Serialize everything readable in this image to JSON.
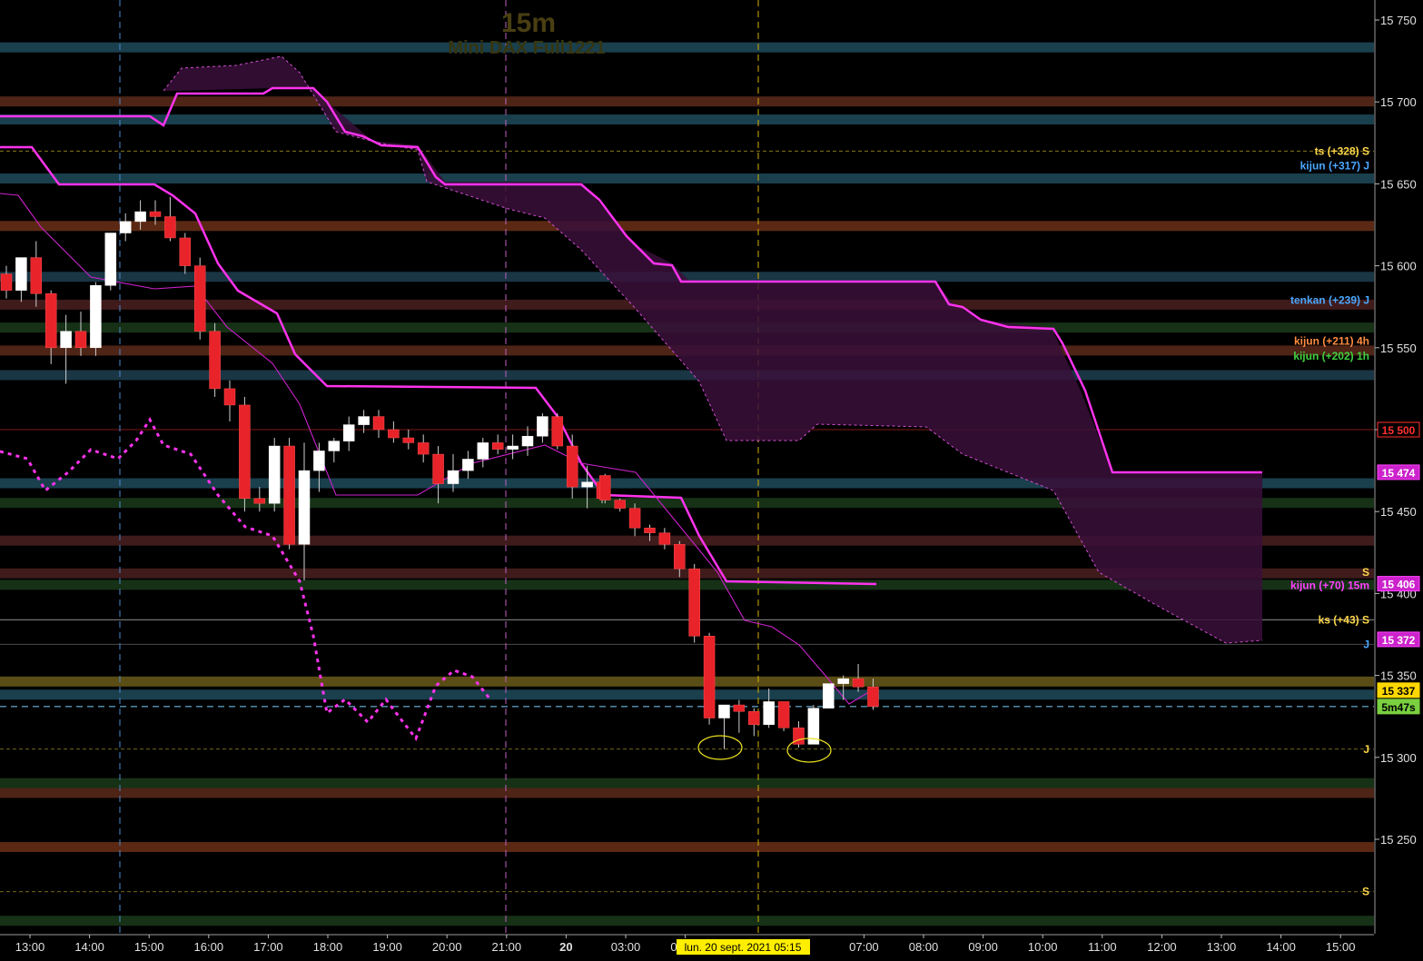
{
  "header": {
    "timeframe": "15m",
    "instrument": "Mini DAX Full1221"
  },
  "colors": {
    "background": "#000000",
    "up_candle": "#ffffff",
    "down_candle": "#e8232a",
    "kijun_line": "#ff33ee",
    "tenkan_line": "#cc22cc",
    "chikou_line": "#ff33ee",
    "cloud_fill": "#3a0f3a",
    "grid_dashed_day": "#c060c0",
    "current_time_line": "#d4b000",
    "price_tag_current": "#ffd700",
    "price_tag_magenta": "#ff22ff"
  },
  "chart_data": {
    "type": "candlestick",
    "ylim": [
      15195,
      15767
    ],
    "y_ticks": [
      "15 750",
      "15 700",
      "15 650",
      "15 600",
      "15 550",
      "15 500",
      "15 450",
      "15 400",
      "15 350",
      "15 300",
      "15 250"
    ],
    "y_tick_values": [
      15750,
      15700,
      15650,
      15600,
      15550,
      15500,
      15450,
      15400,
      15350,
      15300,
      15250
    ],
    "x_labels": [
      "13:00",
      "14:00",
      "15:00",
      "16:00",
      "17:00",
      "18:00",
      "19:00",
      "20:00",
      "21:00",
      "20",
      "03:00",
      "04:00",
      "07:00",
      "08:00",
      "09:00",
      "10:00",
      "11:00",
      "12:00",
      "13:00",
      "14:00",
      "15:00"
    ],
    "x_label_slots": [
      0,
      4,
      8,
      12,
      16,
      20,
      24,
      28,
      32,
      36,
      40,
      44,
      56,
      60,
      64,
      68,
      72,
      76,
      80,
      84,
      88
    ],
    "cursor_label": "lun. 20 sept. 2021 05:15",
    "candles": [
      {
        "o": 15595,
        "h": 15600,
        "l": 15580,
        "c": 15585
      },
      {
        "o": 15585,
        "h": 15605,
        "l": 15578,
        "c": 15605
      },
      {
        "o": 15605,
        "h": 15615,
        "l": 15575,
        "c": 15583
      },
      {
        "o": 15583,
        "h": 15585,
        "l": 15540,
        "c": 15550
      },
      {
        "o": 15550,
        "h": 15570,
        "l": 15528,
        "c": 15560
      },
      {
        "o": 15560,
        "h": 15572,
        "l": 15545,
        "c": 15550
      },
      {
        "o": 15550,
        "h": 15590,
        "l": 15545,
        "c": 15588
      },
      {
        "o": 15588,
        "h": 15620,
        "l": 15585,
        "c": 15620
      },
      {
        "o": 15620,
        "h": 15632,
        "l": 15615,
        "c": 15627
      },
      {
        "o": 15627,
        "h": 15640,
        "l": 15622,
        "c": 15633
      },
      {
        "o": 15633,
        "h": 15640,
        "l": 15625,
        "c": 15630
      },
      {
        "o": 15630,
        "h": 15642,
        "l": 15615,
        "c": 15617
      },
      {
        "o": 15617,
        "h": 15620,
        "l": 15595,
        "c": 15600
      },
      {
        "o": 15600,
        "h": 15605,
        "l": 15555,
        "c": 15560
      },
      {
        "o": 15560,
        "h": 15565,
        "l": 15520,
        "c": 15525
      },
      {
        "o": 15525,
        "h": 15530,
        "l": 15505,
        "c": 15515
      },
      {
        "o": 15515,
        "h": 15520,
        "l": 15450,
        "c": 15458
      },
      {
        "o": 15458,
        "h": 15465,
        "l": 15450,
        "c": 15455
      },
      {
        "o": 15455,
        "h": 15495,
        "l": 15450,
        "c": 15490
      },
      {
        "o": 15490,
        "h": 15495,
        "l": 15427,
        "c": 15430
      },
      {
        "o": 15430,
        "h": 15492,
        "l": 15408,
        "c": 15475
      },
      {
        "o": 15475,
        "h": 15492,
        "l": 15462,
        "c": 15487
      },
      {
        "o": 15487,
        "h": 15495,
        "l": 15480,
        "c": 15493
      },
      {
        "o": 15493,
        "h": 15508,
        "l": 15487,
        "c": 15503
      },
      {
        "o": 15503,
        "h": 15512,
        "l": 15498,
        "c": 15508
      },
      {
        "o": 15508,
        "h": 15512,
        "l": 15495,
        "c": 15500
      },
      {
        "o": 15500,
        "h": 15505,
        "l": 15492,
        "c": 15495
      },
      {
        "o": 15495,
        "h": 15500,
        "l": 15488,
        "c": 15492
      },
      {
        "o": 15492,
        "h": 15497,
        "l": 15480,
        "c": 15485
      },
      {
        "o": 15485,
        "h": 15490,
        "l": 15455,
        "c": 15467
      },
      {
        "o": 15467,
        "h": 15485,
        "l": 15462,
        "c": 15475
      },
      {
        "o": 15475,
        "h": 15487,
        "l": 15470,
        "c": 15482
      },
      {
        "o": 15482,
        "h": 15495,
        "l": 15477,
        "c": 15492
      },
      {
        "o": 15492,
        "h": 15497,
        "l": 15485,
        "c": 15488
      },
      {
        "o": 15488,
        "h": 15497,
        "l": 15482,
        "c": 15490
      },
      {
        "o": 15490,
        "h": 15502,
        "l": 15484,
        "c": 15496
      },
      {
        "o": 15496,
        "h": 15510,
        "l": 15492,
        "c": 15508
      },
      {
        "o": 15508,
        "h": 15510,
        "l": 15488,
        "c": 15490
      },
      {
        "o": 15490,
        "h": 15497,
        "l": 15458,
        "c": 15465
      },
      {
        "o": 15465,
        "h": 15478,
        "l": 15452,
        "c": 15468
      },
      {
        "o": 15468,
        "h": 15470,
        "l": 15455,
        "c": 15458
      }
    ],
    "candles_2": [
      {
        "o": 15472,
        "h": 15473,
        "l": 15455,
        "c": 15457
      },
      {
        "o": 15457,
        "h": 15458,
        "l": 15450,
        "c": 15452
      },
      {
        "o": 15452,
        "h": 15455,
        "l": 15435,
        "c": 15440
      },
      {
        "o": 15440,
        "h": 15442,
        "l": 15432,
        "c": 15437
      },
      {
        "o": 15437,
        "h": 15440,
        "l": 15427,
        "c": 15430
      },
      {
        "o": 15430,
        "h": 15432,
        "l": 15410,
        "c": 15415
      },
      {
        "o": 15415,
        "h": 15418,
        "l": 15370,
        "c": 15374
      },
      {
        "o": 15374,
        "h": 15376,
        "l": 15320,
        "c": 15324
      },
      {
        "o": 15324,
        "h": 15332,
        "l": 15305,
        "c": 15332
      },
      {
        "o": 15332,
        "h": 15335,
        "l": 15315,
        "c": 15328
      },
      {
        "o": 15328,
        "h": 15330,
        "l": 15313,
        "c": 15320
      },
      {
        "o": 15320,
        "h": 15342,
        "l": 15318,
        "c": 15334
      },
      {
        "o": 15334,
        "h": 15334,
        "l": 15316,
        "c": 15318
      },
      {
        "o": 15318,
        "h": 15322,
        "l": 15306,
        "c": 15308
      },
      {
        "o": 15308,
        "h": 15332,
        "l": 15308,
        "c": 15330
      },
      {
        "o": 15330,
        "h": 15345,
        "l": 15330,
        "c": 15345
      },
      {
        "o": 15345,
        "h": 15350,
        "l": 15335,
        "c": 15348
      },
      {
        "o": 15348,
        "h": 15357,
        "l": 15340,
        "c": 15343
      },
      {
        "o": 15343,
        "h": 15348,
        "l": 15329,
        "c": 15331
      }
    ],
    "horizontal_zones": [
      {
        "price": 15733,
        "color": "#1e4a5a"
      },
      {
        "price": 15700,
        "color": "#5a2a1a"
      },
      {
        "price": 15689,
        "color": "#1e4a5a"
      },
      {
        "price": 15653,
        "color": "#1e4a5a"
      },
      {
        "price": 15624,
        "color": "#6b3016"
      },
      {
        "price": 15593,
        "color": "#1e3e50"
      },
      {
        "price": 15576,
        "color": "#4a2020"
      },
      {
        "price": 15562,
        "color": "#1a3a1a"
      },
      {
        "price": 15548,
        "color": "#5a2a1a"
      },
      {
        "price": 15533,
        "color": "#1e3e50"
      },
      {
        "price": 15467,
        "color": "#1e4a5a"
      },
      {
        "price": 15455,
        "color": "#1a3a1a"
      },
      {
        "price": 15432,
        "color": "#4a2020"
      },
      {
        "price": 15412,
        "color": "#4a2020"
      },
      {
        "price": 15405,
        "color": "#1a3a1a"
      },
      {
        "price": 15346,
        "color": "#6b5a1a"
      },
      {
        "price": 15338,
        "color": "#1e4a5a"
      },
      {
        "price": 15284,
        "color": "#1a3a1a"
      },
      {
        "price": 15278,
        "color": "#5a2a1a"
      },
      {
        "price": 15245,
        "color": "#6b3016"
      },
      {
        "price": 15200,
        "color": "#1a3a1a"
      }
    ],
    "annotations": [
      {
        "text": "ts (+328)  S",
        "price": 15670,
        "color": "#ffd84a"
      },
      {
        "text": "kijun (+317)  J",
        "price": 15661,
        "color": "#4aa8ff"
      },
      {
        "text": "tenkan (+239)  J",
        "price": 15579,
        "color": "#4aa8ff"
      },
      {
        "text": "kijun (+211)  4h",
        "price": 15554,
        "color": "#ff8c40"
      },
      {
        "text": "kijun (+202)  1h",
        "price": 15545,
        "color": "#40d040"
      },
      {
        "text": "S",
        "price": 15413,
        "color": "#ffd84a"
      },
      {
        "text": "kijun (+70)  15m",
        "price": 15405,
        "color": "#ff40ff"
      },
      {
        "text": "ks (+43)  S",
        "price": 15384,
        "color": "#ffd84a"
      },
      {
        "text": "J",
        "price": 15369,
        "color": "#4aa8ff"
      },
      {
        "text": "J",
        "price": 15305,
        "color": "#ffd84a"
      },
      {
        "text": "S",
        "price": 15218,
        "color": "#ffd84a"
      }
    ],
    "price_tags": [
      {
        "text": "15 500",
        "price": 15500,
        "bg": "#000000",
        "fg": "#ff3030",
        "border": "#ff3030"
      },
      {
        "text": "15 474",
        "price": 15474,
        "bg": "#cc22cc",
        "fg": "#ffffff",
        "border": "#ff44ff"
      },
      {
        "text": "15 406",
        "price": 15406,
        "bg": "#cc22cc",
        "fg": "#ffffff",
        "border": "#ff44ff"
      },
      {
        "text": "15 372",
        "price": 15372,
        "bg": "#cc22cc",
        "fg": "#ffffff",
        "border": "#ff44ff"
      },
      {
        "text": "15 337",
        "price": 15341,
        "bg": "#ffd700",
        "fg": "#000000",
        "border": "#ffd700"
      },
      {
        "text": "5m47s",
        "price": 15331,
        "bg": "#7ad040",
        "fg": "#000000",
        "border": "#7ad040"
      }
    ]
  }
}
